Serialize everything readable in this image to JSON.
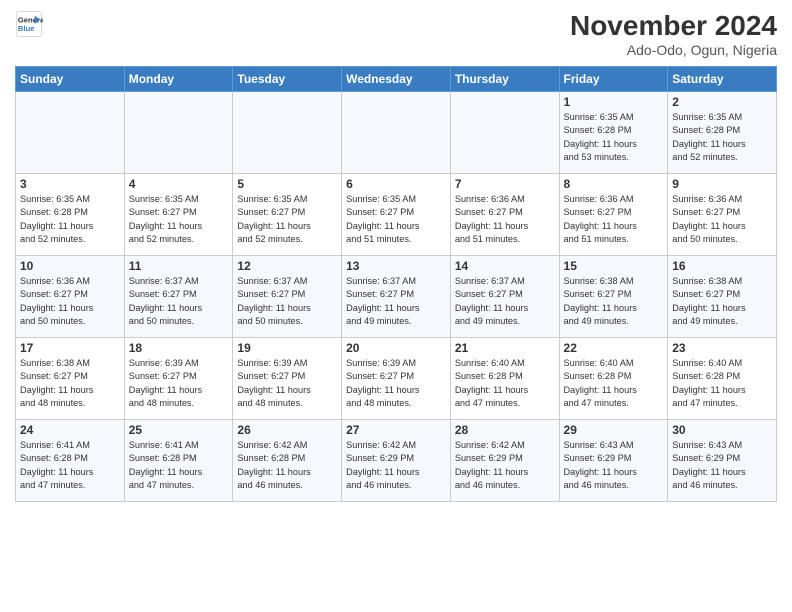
{
  "header": {
    "logo_line1": "General",
    "logo_line2": "Blue",
    "month": "November 2024",
    "location": "Ado-Odo, Ogun, Nigeria"
  },
  "weekdays": [
    "Sunday",
    "Monday",
    "Tuesday",
    "Wednesday",
    "Thursday",
    "Friday",
    "Saturday"
  ],
  "weeks": [
    [
      {
        "day": "",
        "info": ""
      },
      {
        "day": "",
        "info": ""
      },
      {
        "day": "",
        "info": ""
      },
      {
        "day": "",
        "info": ""
      },
      {
        "day": "",
        "info": ""
      },
      {
        "day": "1",
        "info": "Sunrise: 6:35 AM\nSunset: 6:28 PM\nDaylight: 11 hours\nand 53 minutes."
      },
      {
        "day": "2",
        "info": "Sunrise: 6:35 AM\nSunset: 6:28 PM\nDaylight: 11 hours\nand 52 minutes."
      }
    ],
    [
      {
        "day": "3",
        "info": "Sunrise: 6:35 AM\nSunset: 6:28 PM\nDaylight: 11 hours\nand 52 minutes."
      },
      {
        "day": "4",
        "info": "Sunrise: 6:35 AM\nSunset: 6:27 PM\nDaylight: 11 hours\nand 52 minutes."
      },
      {
        "day": "5",
        "info": "Sunrise: 6:35 AM\nSunset: 6:27 PM\nDaylight: 11 hours\nand 52 minutes."
      },
      {
        "day": "6",
        "info": "Sunrise: 6:35 AM\nSunset: 6:27 PM\nDaylight: 11 hours\nand 51 minutes."
      },
      {
        "day": "7",
        "info": "Sunrise: 6:36 AM\nSunset: 6:27 PM\nDaylight: 11 hours\nand 51 minutes."
      },
      {
        "day": "8",
        "info": "Sunrise: 6:36 AM\nSunset: 6:27 PM\nDaylight: 11 hours\nand 51 minutes."
      },
      {
        "day": "9",
        "info": "Sunrise: 6:36 AM\nSunset: 6:27 PM\nDaylight: 11 hours\nand 50 minutes."
      }
    ],
    [
      {
        "day": "10",
        "info": "Sunrise: 6:36 AM\nSunset: 6:27 PM\nDaylight: 11 hours\nand 50 minutes."
      },
      {
        "day": "11",
        "info": "Sunrise: 6:37 AM\nSunset: 6:27 PM\nDaylight: 11 hours\nand 50 minutes."
      },
      {
        "day": "12",
        "info": "Sunrise: 6:37 AM\nSunset: 6:27 PM\nDaylight: 11 hours\nand 50 minutes."
      },
      {
        "day": "13",
        "info": "Sunrise: 6:37 AM\nSunset: 6:27 PM\nDaylight: 11 hours\nand 49 minutes."
      },
      {
        "day": "14",
        "info": "Sunrise: 6:37 AM\nSunset: 6:27 PM\nDaylight: 11 hours\nand 49 minutes."
      },
      {
        "day": "15",
        "info": "Sunrise: 6:38 AM\nSunset: 6:27 PM\nDaylight: 11 hours\nand 49 minutes."
      },
      {
        "day": "16",
        "info": "Sunrise: 6:38 AM\nSunset: 6:27 PM\nDaylight: 11 hours\nand 49 minutes."
      }
    ],
    [
      {
        "day": "17",
        "info": "Sunrise: 6:38 AM\nSunset: 6:27 PM\nDaylight: 11 hours\nand 48 minutes."
      },
      {
        "day": "18",
        "info": "Sunrise: 6:39 AM\nSunset: 6:27 PM\nDaylight: 11 hours\nand 48 minutes."
      },
      {
        "day": "19",
        "info": "Sunrise: 6:39 AM\nSunset: 6:27 PM\nDaylight: 11 hours\nand 48 minutes."
      },
      {
        "day": "20",
        "info": "Sunrise: 6:39 AM\nSunset: 6:27 PM\nDaylight: 11 hours\nand 48 minutes."
      },
      {
        "day": "21",
        "info": "Sunrise: 6:40 AM\nSunset: 6:28 PM\nDaylight: 11 hours\nand 47 minutes."
      },
      {
        "day": "22",
        "info": "Sunrise: 6:40 AM\nSunset: 6:28 PM\nDaylight: 11 hours\nand 47 minutes."
      },
      {
        "day": "23",
        "info": "Sunrise: 6:40 AM\nSunset: 6:28 PM\nDaylight: 11 hours\nand 47 minutes."
      }
    ],
    [
      {
        "day": "24",
        "info": "Sunrise: 6:41 AM\nSunset: 6:28 PM\nDaylight: 11 hours\nand 47 minutes."
      },
      {
        "day": "25",
        "info": "Sunrise: 6:41 AM\nSunset: 6:28 PM\nDaylight: 11 hours\nand 47 minutes."
      },
      {
        "day": "26",
        "info": "Sunrise: 6:42 AM\nSunset: 6:28 PM\nDaylight: 11 hours\nand 46 minutes."
      },
      {
        "day": "27",
        "info": "Sunrise: 6:42 AM\nSunset: 6:29 PM\nDaylight: 11 hours\nand 46 minutes."
      },
      {
        "day": "28",
        "info": "Sunrise: 6:42 AM\nSunset: 6:29 PM\nDaylight: 11 hours\nand 46 minutes."
      },
      {
        "day": "29",
        "info": "Sunrise: 6:43 AM\nSunset: 6:29 PM\nDaylight: 11 hours\nand 46 minutes."
      },
      {
        "day": "30",
        "info": "Sunrise: 6:43 AM\nSunset: 6:29 PM\nDaylight: 11 hours\nand 46 minutes."
      }
    ]
  ]
}
